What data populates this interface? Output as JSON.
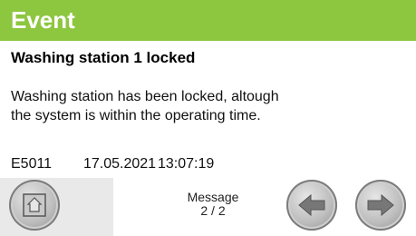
{
  "header": {
    "title": "Event",
    "accent_color": "#8dc63f"
  },
  "event": {
    "headline": "Washing station 1 locked",
    "description_line1": "Washing station has been locked, altough",
    "description_line2": "the system is within the operating time.",
    "code": "E5011",
    "date": "17.05.2021",
    "time": "13:07:19"
  },
  "footer": {
    "message_label": "Message",
    "page_indicator": "2 / 2",
    "home_icon": "home-icon",
    "prev_icon": "arrow-left-icon",
    "next_icon": "arrow-right-icon"
  }
}
